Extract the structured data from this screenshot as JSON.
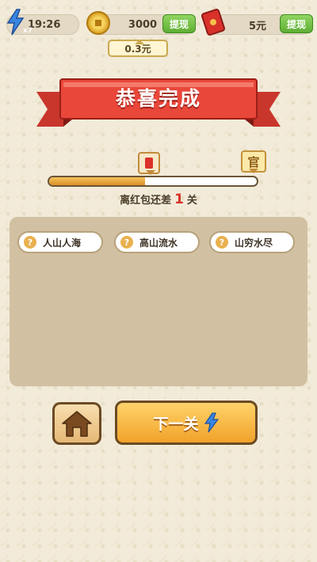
{
  "top_bar": {
    "energy": {
      "count": "x7",
      "time": "19:26"
    },
    "coins": {
      "value": "3000",
      "withdraw_label": "提现",
      "tip": "0.3元"
    },
    "red_packet": {
      "value": "5元",
      "withdraw_label": "提现"
    }
  },
  "banner": {
    "title": "恭喜完成"
  },
  "progress": {
    "fraction": 0.46,
    "official_badge": "官",
    "remaining_prefix": "离红包还差",
    "remaining_count": "1",
    "remaining_suffix": "关"
  },
  "answers": [
    {
      "text": "人山人海"
    },
    {
      "text": "高山流水"
    },
    {
      "text": "山穷水尽"
    }
  ],
  "buttons": {
    "next_label": "下一关"
  },
  "colors": {
    "accent_red": "#d8322a",
    "withdraw_green": "#5fae34",
    "next_orange": "#f1a22a"
  }
}
